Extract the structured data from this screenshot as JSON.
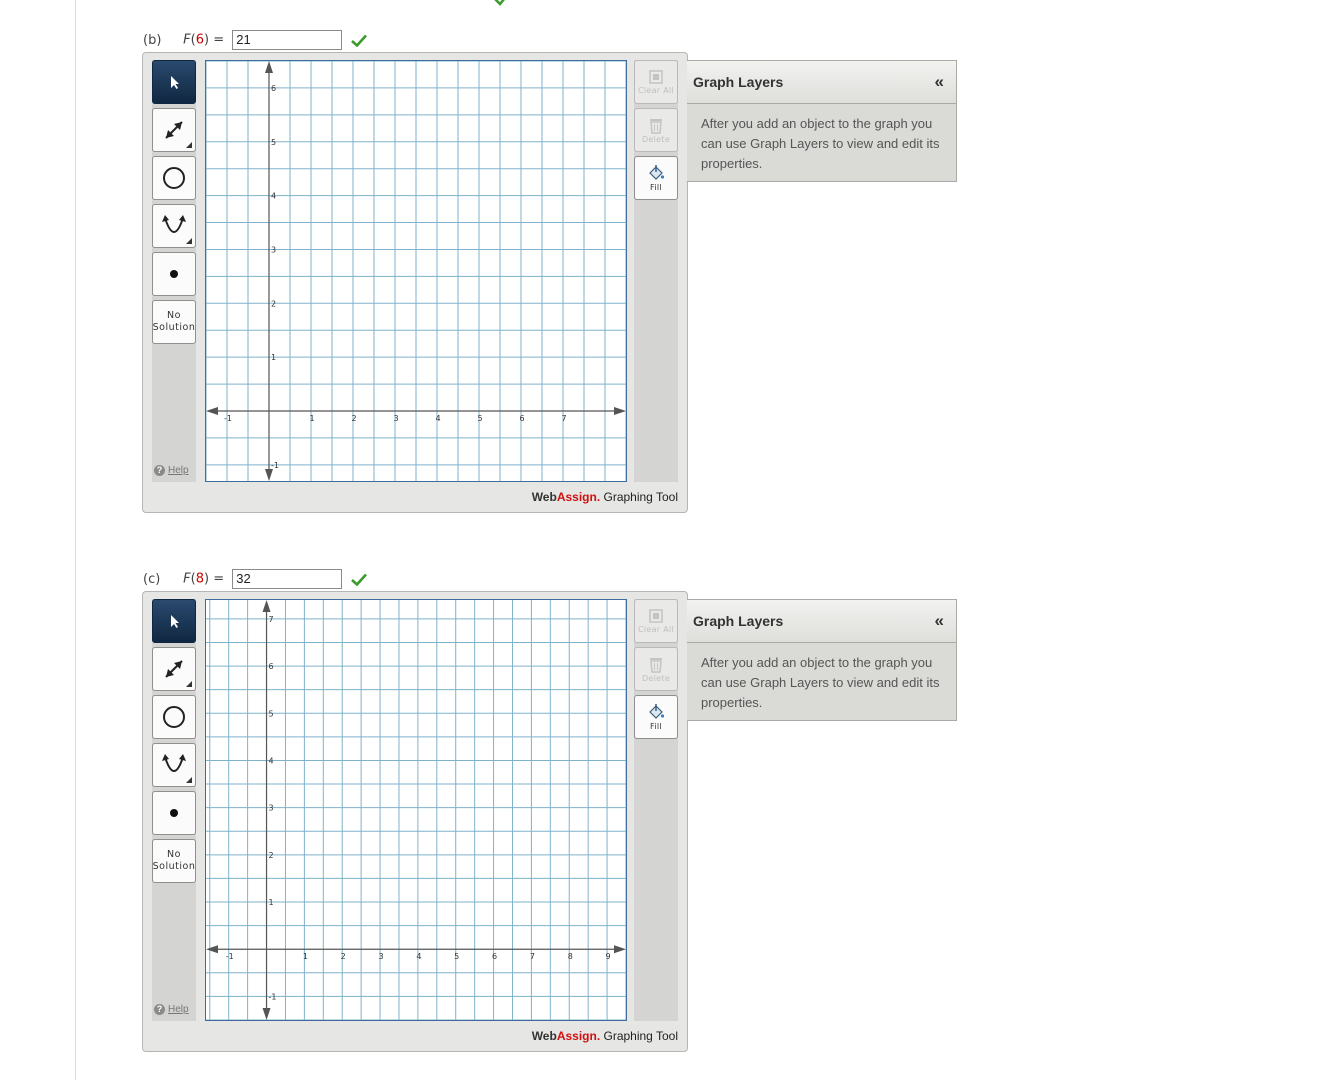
{
  "part_b": {
    "label": "(b)",
    "function_name": "F",
    "argument": "6",
    "equals": "=",
    "answer": "21"
  },
  "part_c": {
    "label": "(c)",
    "function_name": "F",
    "argument": "8",
    "equals": "=",
    "answer": "32"
  },
  "toolbar": {
    "select_icon": "pointer-arrow-icon",
    "line_icon": "double-arrow-line-icon",
    "circle_icon": "circle-icon",
    "parabola_icon": "parabola-icon",
    "point_icon": "point-icon",
    "no_solution_line1": "No",
    "no_solution_line2": "Solution",
    "help_label": "Help"
  },
  "right_toolbar": {
    "clear_all_label": "Clear All",
    "delete_label": "Delete",
    "fill_label": "Fill"
  },
  "brand": {
    "web": "Web",
    "assign": "Assign.",
    "rest": " Graphing Tool"
  },
  "layers_panel": {
    "title": "Graph Layers",
    "collapse": "«",
    "description": "After you add an object to the graph you can use Graph Layers to view and edit its properties."
  },
  "graph_b": {
    "x_ticks": [
      "-1",
      "1",
      "2",
      "3",
      "4",
      "5",
      "6",
      "7"
    ],
    "y_ticks": [
      "6",
      "5",
      "4",
      "3",
      "2",
      "1",
      "-1"
    ],
    "xlim": [
      -1.5,
      8.5
    ],
    "ylim": [
      -1.3,
      6.5
    ]
  },
  "graph_c": {
    "x_ticks": [
      "-1",
      "1",
      "2",
      "3",
      "4",
      "5",
      "6",
      "7",
      "8",
      "9"
    ],
    "y_ticks": [
      "7",
      "6",
      "5",
      "4",
      "3",
      "2",
      "1",
      "-1"
    ],
    "xlim": [
      -1.6,
      9.5
    ],
    "ylim": [
      -1.5,
      7.4
    ]
  },
  "colors": {
    "grid_line": "#7fb2cc",
    "axis": "#555555",
    "active_tool": "#1b3556",
    "check": "#3a9a2a",
    "brand_red": "#d01010"
  }
}
